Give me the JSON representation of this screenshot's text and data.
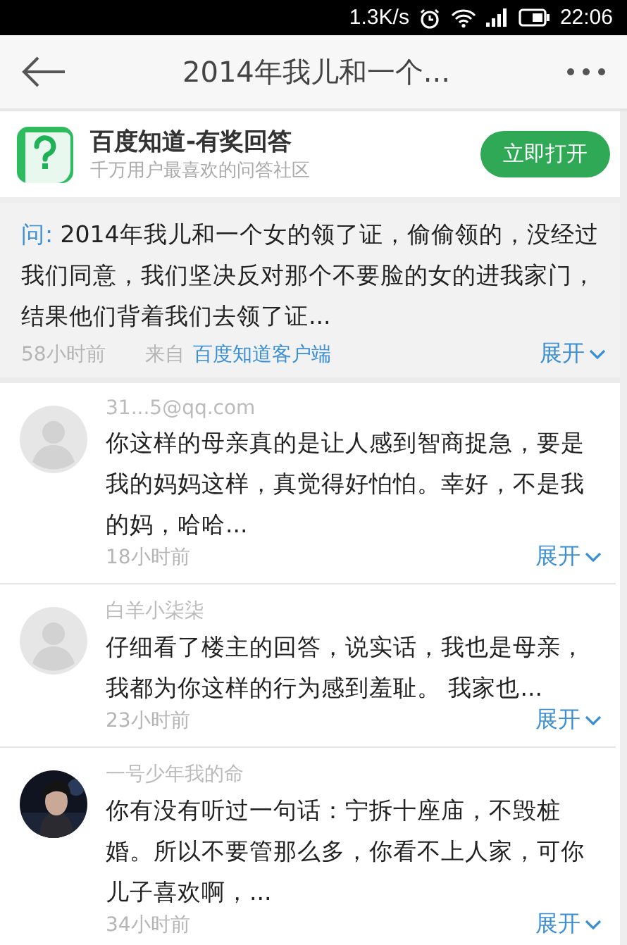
{
  "status_bar": {
    "speed": "1.3K/s",
    "time": "22:06"
  },
  "header": {
    "title": "2014年我儿和一个..."
  },
  "app_banner": {
    "name": "百度知道-有奖回答",
    "tagline": "千万用户最喜欢的问答社区",
    "button": "立即打开"
  },
  "question": {
    "prefix": "问:",
    "text": "2014年我儿和一个女的领了证，偷偷领的，没经过我们同意，我们坚决反对那个不要脸的女的进我家门，结果他们背着我们去领了证...",
    "time": "58小时前",
    "source_label": "来自",
    "source": "百度知道客户端",
    "expand": "展开"
  },
  "answers": [
    {
      "kind": "placeholder",
      "user": "31...5@qq.com",
      "text": "你这样的母亲真的是让人感到智商捉急，要是我的妈妈这样，真觉得好怕怕。幸好，不是我的妈，哈哈...",
      "time": "18小时前",
      "expand": "展开"
    },
    {
      "kind": "placeholder",
      "user": "白羊小柒柒",
      "text": "仔细看了楼主的回答，说实话，我也是母亲，我都为你这样的行为感到羞耻。 我家也...",
      "time": "23小时前",
      "expand": "展开"
    },
    {
      "kind": "picture",
      "user": "一号少年我的命",
      "text": "你有没有听过一句话：宁拆十座庙，不毁桩婚。所以不要管那么多，你看不上人家，可你儿子喜欢啊，...",
      "time": "34小时前",
      "expand": "展开"
    }
  ]
}
